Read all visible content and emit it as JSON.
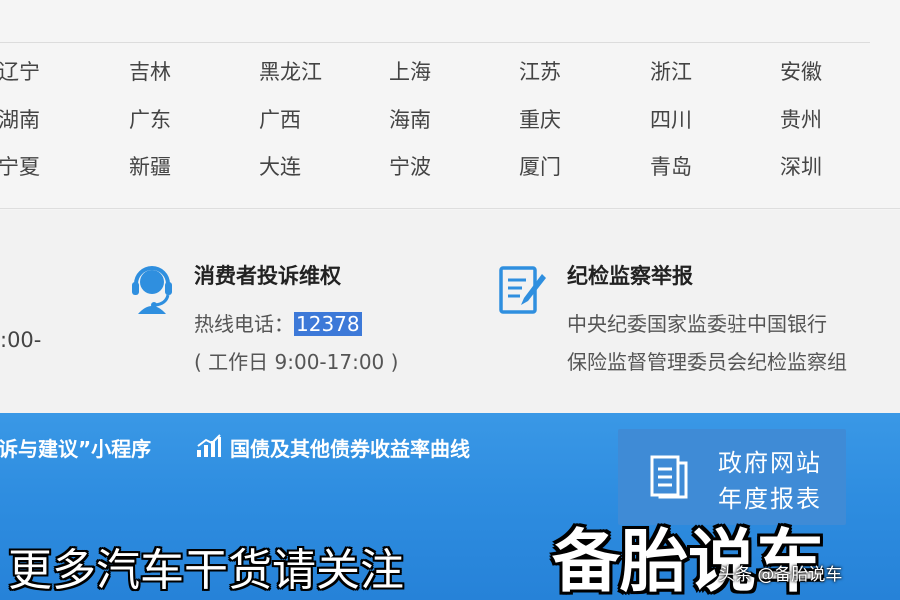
{
  "regions": {
    "rows": [
      [
        "辽宁",
        "吉林",
        "黑龙江",
        "上海",
        "江苏",
        "浙江",
        "安徽"
      ],
      [
        "湖南",
        "广东",
        "广西",
        "海南",
        "重庆",
        "四川",
        "贵州"
      ],
      [
        "宁夏",
        "新疆",
        "大连",
        "宁波",
        "厦门",
        "青岛",
        "深圳"
      ]
    ]
  },
  "services": {
    "hours_fragment": ":00-",
    "consumer": {
      "title": "消费者投诉维权",
      "hotline_label": "热线电话：",
      "hotline_number": "12378",
      "hours": "( 工作日 9:00-17:00 )"
    },
    "discipline": {
      "title": "纪检监察举报",
      "line1": "中央纪委国家监委驻中国银行",
      "line2": "保险监督管理委员会纪检监察组"
    }
  },
  "bluebar": {
    "miniapp_link": "诉与建议”小程序",
    "bond_link": "国债及其他债券收益率曲线",
    "report_line1": "政府网站",
    "report_line2": "年度报表"
  },
  "overlay": {
    "follow_text": "更多汽车干货请关注",
    "brand": "备胎说车",
    "credit": "头条 @备胎说车"
  },
  "colors": {
    "highlight": "#3d79d8",
    "bar_blue": "#2e8de0",
    "icon_blue": "#2f8fdf"
  }
}
